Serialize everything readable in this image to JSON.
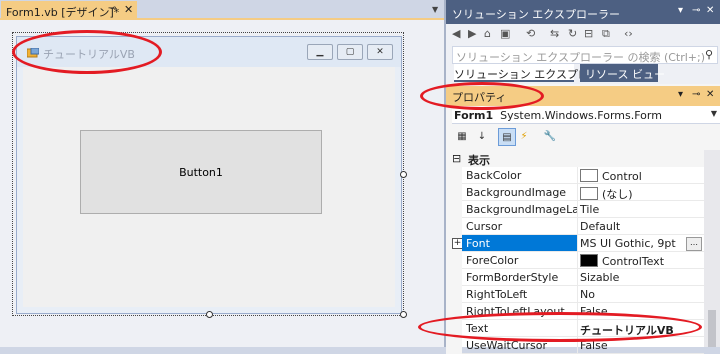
{
  "designer": {
    "tab_title": "Form1.vb [デザイン]*",
    "form_title": "チュートリアルVB",
    "button_text": "Button1"
  },
  "solution_explorer": {
    "title": "ソリューション エクスプローラー",
    "search_placeholder": "ソリューション エクスプローラー の検索 (Ctrl+;)",
    "tab_active": "ソリューション エクスプローラー",
    "tab_other": "リソース ビュー"
  },
  "properties": {
    "title": "プロパティ",
    "object_name": "Form1",
    "object_type": "System.Windows.Forms.Form",
    "category": "表示",
    "rows": [
      {
        "name": "BackColor",
        "value": "Control"
      },
      {
        "name": "BackgroundImage",
        "value": "(なし)"
      },
      {
        "name": "BackgroundImageLayo",
        "value": "Tile"
      },
      {
        "name": "Cursor",
        "value": "Default"
      },
      {
        "name": "Font",
        "value": "MS UI Gothic, 9pt"
      },
      {
        "name": "ForeColor",
        "value": "ControlText"
      },
      {
        "name": "FormBorderStyle",
        "value": "Sizable"
      },
      {
        "name": "RightToLeft",
        "value": "No"
      },
      {
        "name": "RightToLeftLayout",
        "value": "False"
      },
      {
        "name": "Text",
        "value": "チュートリアルVB"
      },
      {
        "name": "UseWaitCursor",
        "value": "False"
      }
    ]
  },
  "colors": {
    "accent_yellow": "#f5cc84",
    "header_blue": "#4d6082",
    "selection_blue": "#0078d7",
    "annotation_red": "#e31b23"
  }
}
